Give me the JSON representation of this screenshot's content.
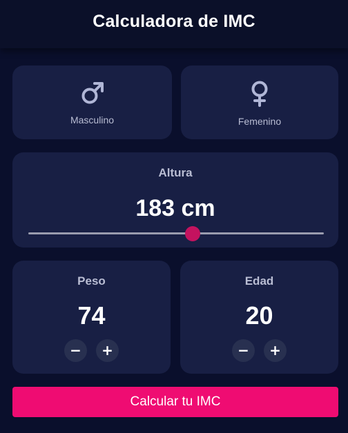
{
  "header": {
    "title": "Calculadora de IMC"
  },
  "gender": {
    "male_label": "Masculino",
    "female_label": "Femenino",
    "icon_color": "#b0b6d6"
  },
  "height": {
    "title": "Altura",
    "value_text": "183 cm",
    "slider_fraction": 0.555
  },
  "weight": {
    "title": "Peso",
    "value": "74",
    "minus": "−",
    "plus": "+"
  },
  "age": {
    "title": "Edad",
    "value": "20",
    "minus": "−",
    "plus": "+"
  },
  "action": {
    "calculate_label": "Calcular tu IMC"
  },
  "colors": {
    "background": "#0a0f2c",
    "card": "#181f44",
    "accent": "#ef0c72",
    "slider_thumb": "#c4135f"
  }
}
